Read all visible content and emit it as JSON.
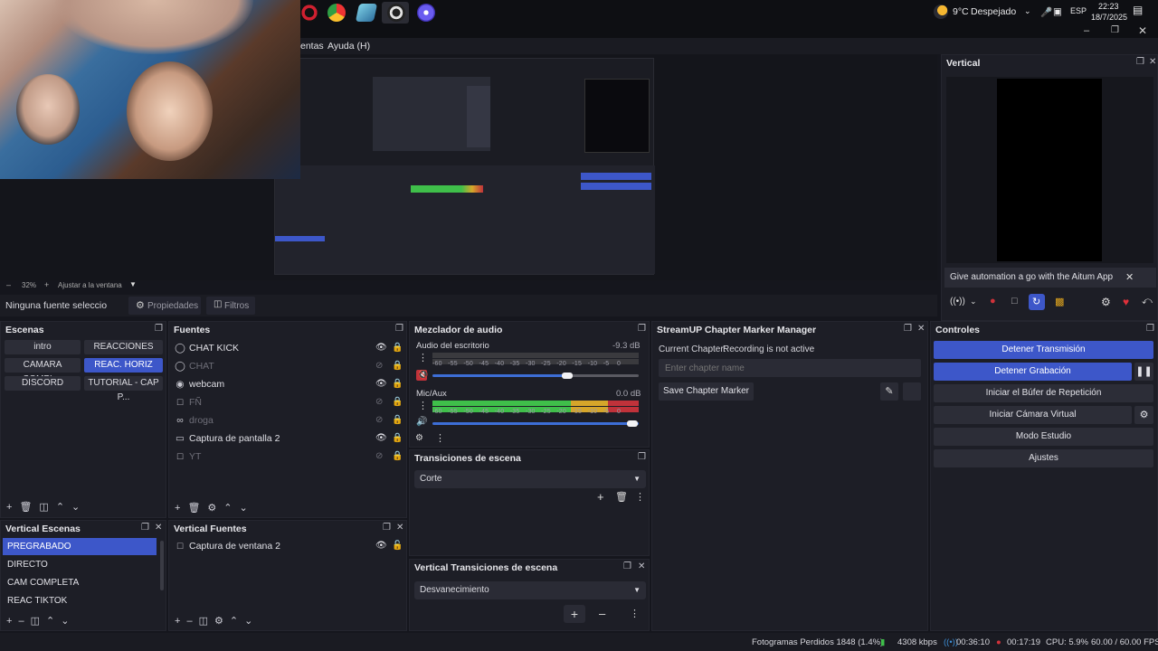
{
  "taskbar": {
    "weather_temp": "9°C",
    "weather_desc": "Despejado",
    "language": "ESP",
    "time": "22:23",
    "date": "18/7/2025"
  },
  "menu": {
    "items": [
      "entas",
      "Ayuda (H)"
    ]
  },
  "preview": {
    "zoom": "32%",
    "fit_label": "Ajustar a la ventana"
  },
  "source_bar": {
    "no_source": "Ninguna fuente seleccionad",
    "properties": "Propiedades",
    "filters": "Filtros"
  },
  "scenes": {
    "title": "Escenas",
    "items": [
      {
        "label": "intro",
        "active": false
      },
      {
        "label": "REACCIONES",
        "active": false
      },
      {
        "label": "CAMARA COMPL...",
        "active": false
      },
      {
        "label": "REAC. HORIZ",
        "active": true
      },
      {
        "label": "DISCORD",
        "active": false
      },
      {
        "label": "TUTORIAL - CAP P...",
        "active": false
      }
    ]
  },
  "sources": {
    "title": "Fuentes",
    "items": [
      {
        "label": "CHAT KICK",
        "icon": "globe-icon",
        "visible": true
      },
      {
        "label": "CHAT",
        "icon": "globe-icon",
        "visible": false
      },
      {
        "label": "webcam",
        "icon": "camera-icon",
        "visible": true
      },
      {
        "label": "FÑ",
        "icon": "window-icon",
        "visible": false
      },
      {
        "label": "droga",
        "icon": "link-icon",
        "visible": false
      },
      {
        "label": "Captura de pantalla 2",
        "icon": "monitor-icon",
        "visible": true
      },
      {
        "label": "YT",
        "icon": "window-icon",
        "visible": false
      }
    ]
  },
  "mixer": {
    "title": "Mezclador de audio",
    "channels": [
      {
        "name": "Audio del escritorio",
        "db": "-9.3 dB",
        "level": 0.0,
        "volume": 0.8,
        "muted": true
      },
      {
        "name": "Mic/Aux",
        "db": "0.0 dB",
        "level": 1.0,
        "volume": 1.0,
        "muted": false
      }
    ],
    "ticks": [
      "-60",
      "-55",
      "-50",
      "-45",
      "-40",
      "-35",
      "-30",
      "-25",
      "-20",
      "-15",
      "-10",
      "-5",
      "0"
    ]
  },
  "transitions": {
    "title": "Transiciones de escena",
    "selected": "Corte"
  },
  "vertical_transitions": {
    "title": "Vertical Transiciones de escena",
    "selected": "Desvanecimiento"
  },
  "chapter": {
    "title": "StreamUP Chapter Marker Manager",
    "current_label": "Current Chapter:",
    "current_value": "Recording is not active",
    "input_placeholder": "Enter chapter name",
    "save_label": "Save Chapter Marker"
  },
  "vertical": {
    "title": "Vertical",
    "banner": "Give automation a go with the Aitum App"
  },
  "controls": {
    "title": "Controles",
    "buttons": [
      {
        "label": "Detener Transmisión",
        "active": true
      },
      {
        "label": "Detener Grabación",
        "active": true
      },
      {
        "label": "Iniciar el Búfer de Repetición",
        "active": false
      },
      {
        "label": "Iniciar Cámara Virtual",
        "active": false
      },
      {
        "label": "Modo Estudio",
        "active": false
      },
      {
        "label": "Ajustes",
        "active": false
      }
    ]
  },
  "vertical_scenes": {
    "title": "Vertical Escenas",
    "items": [
      {
        "label": "PREGRABADO",
        "active": true
      },
      {
        "label": "DIRECTO",
        "active": false
      },
      {
        "label": "CAM COMPLETA",
        "active": false
      },
      {
        "label": "REAC TIKTOK",
        "active": false
      }
    ]
  },
  "vertical_sources": {
    "title": "Vertical Fuentes",
    "items": [
      {
        "label": "Captura de ventana 2",
        "icon": "window-icon",
        "visible": true
      }
    ]
  },
  "status": {
    "dropped": "Fotogramas Perdidos 1848 (1.4%)",
    "bitrate": "4308 kbps",
    "stream_time": "00:36:10",
    "rec_time": "00:17:19",
    "cpu": "CPU: 5.9%",
    "fps": "60.00 / 60.00 FPS"
  },
  "colors": {
    "accent": "#3d57c9",
    "panel": "#1d1e26",
    "meter_green": "#3fbf4a",
    "meter_yellow": "#d6a62a",
    "meter_red": "#c0323a"
  }
}
